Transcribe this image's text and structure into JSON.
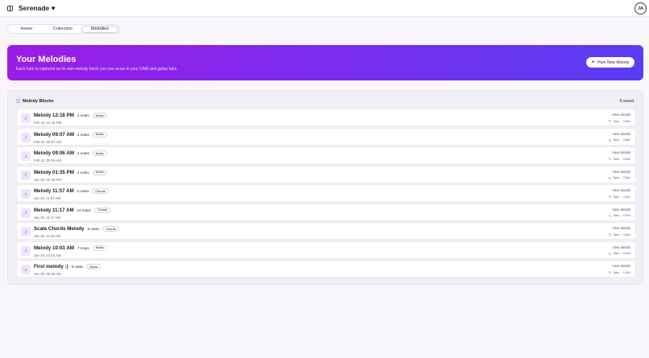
{
  "app": {
    "title": "Serenade",
    "heart": "♥",
    "avatar": "JA"
  },
  "tabs": [
    {
      "label": "Home",
      "active": false
    },
    {
      "label": "Collection",
      "active": false
    },
    {
      "label": "Melodies",
      "active": true
    }
  ],
  "hero": {
    "title": "Your Melodies",
    "subtitle": "Each hum is captured as its own melody block you can reuse in your DAW and guitar tabs.",
    "button": "Hum New Melody",
    "gradient": [
      "#9b1de6",
      "#7b2cf0",
      "#5a3df2"
    ]
  },
  "panel": {
    "title": "Melody Blocks",
    "count": "9 saved",
    "items": [
      {
        "name": "Melody 12:18 PM",
        "notes": "4 notes",
        "badge": "Notes",
        "date": "Feb 10, 12:18 PM",
        "details": "View details",
        "tabs": "Tabs",
        "daw": "DAW"
      },
      {
        "name": "Melody 09:07 AM",
        "notes": "2 notes",
        "badge": "Notes",
        "date": "Feb 10, 09:07 AM",
        "details": "View details",
        "tabs": "Tabs",
        "daw": "DAW"
      },
      {
        "name": "Melody 09:06 AM",
        "notes": "2 notes",
        "badge": "Notes",
        "date": "Feb 10, 09:06 AM",
        "details": "View details",
        "tabs": "Tabs",
        "daw": "DAW"
      },
      {
        "name": "Melody 01:35 PM",
        "notes": "4 notes",
        "badge": "Notes",
        "date": "Jan 29, 01:35 PM",
        "details": "View details",
        "tabs": "Tabs",
        "daw": "DAW"
      },
      {
        "name": "Melody 11:57 AM",
        "notes": "3 notes",
        "badge": "Chords",
        "date": "Jan 29, 11:57 AM",
        "details": "View details",
        "tabs": "Tabs",
        "daw": "DAW"
      },
      {
        "name": "Melody 11:17 AM",
        "notes": "14 notes",
        "badge": "Chords",
        "date": "Jan 29, 11:17 AM",
        "details": "View details",
        "tabs": "Tabs",
        "daw": "DAW"
      },
      {
        "name": "Scale Chords Melody",
        "notes": "5 notes",
        "badge": "Chords",
        "date": "Jan 29, 11:08 AM",
        "details": "View details",
        "tabs": "Tabs",
        "daw": "DAW"
      },
      {
        "name": "Melody 10:03 AM",
        "notes": "7 notes",
        "badge": "Notes",
        "date": "Jan 29, 10:03 AM",
        "details": "View details",
        "tabs": "Tabs",
        "daw": "DAW"
      },
      {
        "name": "First melody :)",
        "notes": "5 notes",
        "badge": "Notes",
        "date": "Jan 29, 08:30 AM",
        "details": "View details",
        "tabs": "Tabs",
        "daw": "DAW"
      }
    ]
  },
  "icons": {
    "sidebar": "sidebar-toggle-icon",
    "sparkle": "sparkle-icon",
    "blocks": "blocks-icon",
    "note": "music-note-icon",
    "pen": "pen-icon"
  }
}
